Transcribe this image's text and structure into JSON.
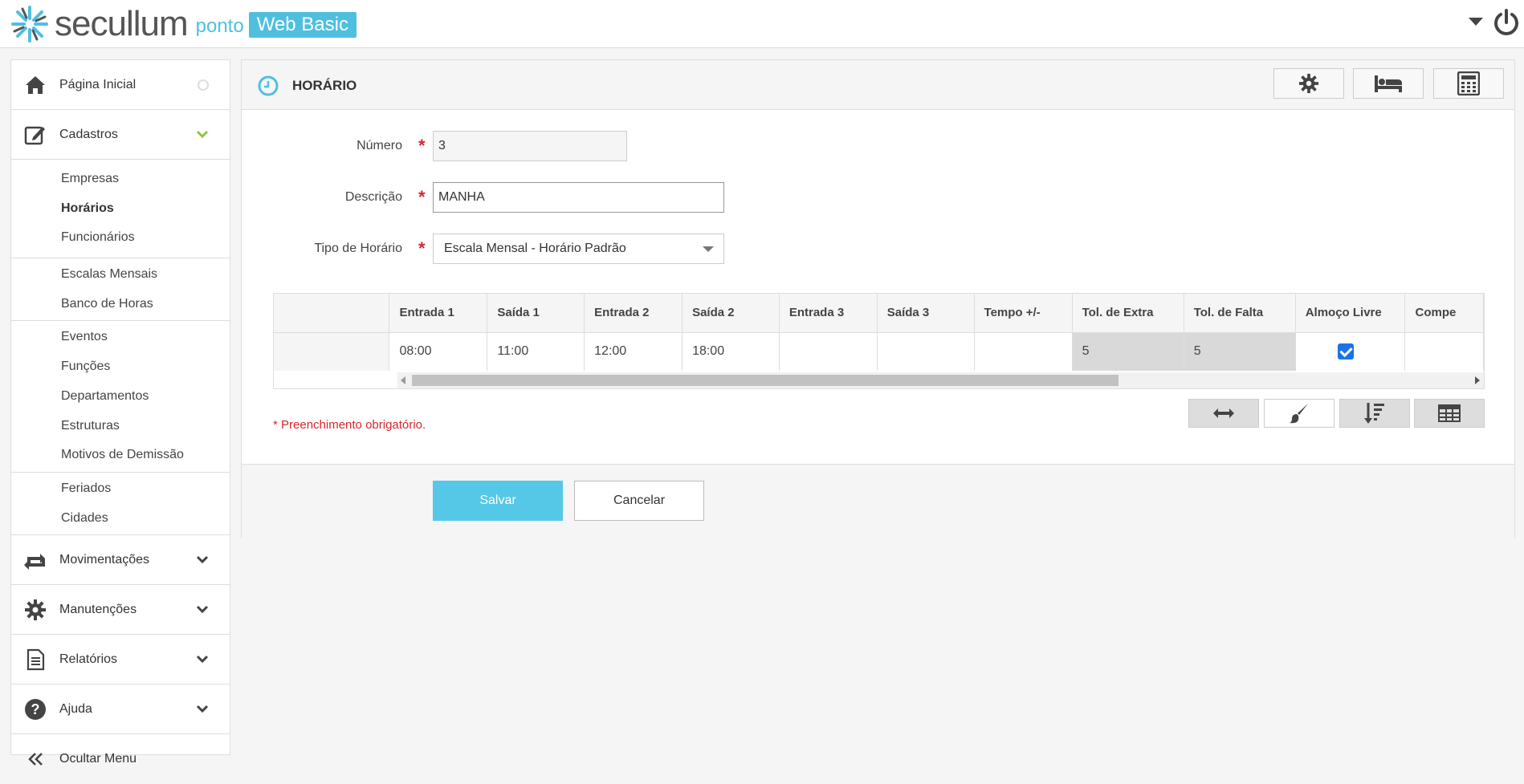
{
  "header": {
    "logo_text": "secullum",
    "logo_ponto": "ponto",
    "logo_badge": "Web Basic"
  },
  "sidebar": {
    "items": [
      {
        "label": "Página Inicial",
        "icon": "home-icon"
      },
      {
        "label": "Cadastros",
        "icon": "edit-icon"
      },
      {
        "label": "Movimentações",
        "icon": "transfer-icon"
      },
      {
        "label": "Manutenções",
        "icon": "gear-icon"
      },
      {
        "label": "Relatórios",
        "icon": "document-icon"
      },
      {
        "label": "Ajuda",
        "icon": "help-icon"
      },
      {
        "label": "Ocultar Menu",
        "icon": "double-chevron-left-icon"
      }
    ],
    "cadastros_groups": [
      [
        "Empresas",
        "Horários",
        "Funcionários"
      ],
      [
        "Escalas Mensais",
        "Banco de Horas"
      ],
      [
        "Eventos",
        "Funções",
        "Departamentos",
        "Estruturas",
        "Motivos de Demissão"
      ],
      [
        "Feriados",
        "Cidades"
      ]
    ],
    "active_sub": "Horários",
    "colors": {
      "expanded_chevron": "#8cc63f"
    }
  },
  "panel": {
    "title": "HORÁRIO",
    "header_buttons": [
      "gear-icon",
      "bed-icon",
      "calculator-icon"
    ],
    "form": {
      "numero_label": "Número",
      "numero_value": "3",
      "descricao_label": "Descrição",
      "descricao_value": "MANHA",
      "tipo_label": "Tipo de Horário",
      "tipo_value": "Escala Mensal - Horário Padrão"
    },
    "grid": {
      "columns": [
        "Entrada 1",
        "Saída 1",
        "Entrada 2",
        "Saída 2",
        "Entrada 3",
        "Saída 3",
        "Tempo +/-",
        "Tol. de Extra",
        "Tol. de Falta",
        "Almoço Livre",
        "Compe"
      ],
      "row": [
        "08:00",
        "11:00",
        "12:00",
        "18:00",
        "",
        "",
        "",
        "5",
        "5"
      ],
      "almoco_livre_checked": true
    },
    "tool_buttons": [
      "arrows-horizontal-icon",
      "brush-icon",
      "sort-icon",
      "table-icon"
    ],
    "required_note": "* Preenchimento obrigatório.",
    "save_label": "Salvar",
    "cancel_label": "Cancelar"
  },
  "colors": {
    "accent": "#55c8e8",
    "required": "#d9252f",
    "checkbox": "#1a73e8"
  }
}
